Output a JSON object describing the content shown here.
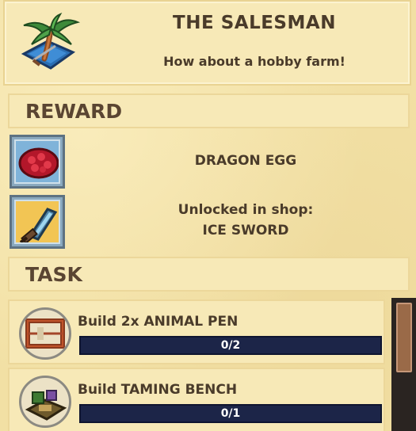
{
  "quest": {
    "title": "THE SALESMAN",
    "subtitle": "How about a hobby farm!",
    "icon": "palm-island-icon"
  },
  "reward_section": {
    "heading": "REWARD",
    "items": [
      {
        "label": "DRAGON EGG",
        "icon": "dragon-egg-icon"
      },
      {
        "label_line1": "Unlocked in shop:",
        "label_line2": "ICE SWORD",
        "icon": "ice-sword-icon"
      }
    ]
  },
  "task_section": {
    "heading": "TASK",
    "tasks": [
      {
        "label": "Build 2x ANIMAL PEN",
        "progress_text": "0/2",
        "progress": 0,
        "icon": "animal-pen-icon"
      },
      {
        "label": "Build TAMING BENCH",
        "progress_text": "0/1",
        "progress": 0,
        "icon": "taming-bench-icon"
      }
    ]
  },
  "colors": {
    "parchment": "#f2e0a4",
    "progress_bg": "#1c2548",
    "text": "#4a3b2a"
  }
}
